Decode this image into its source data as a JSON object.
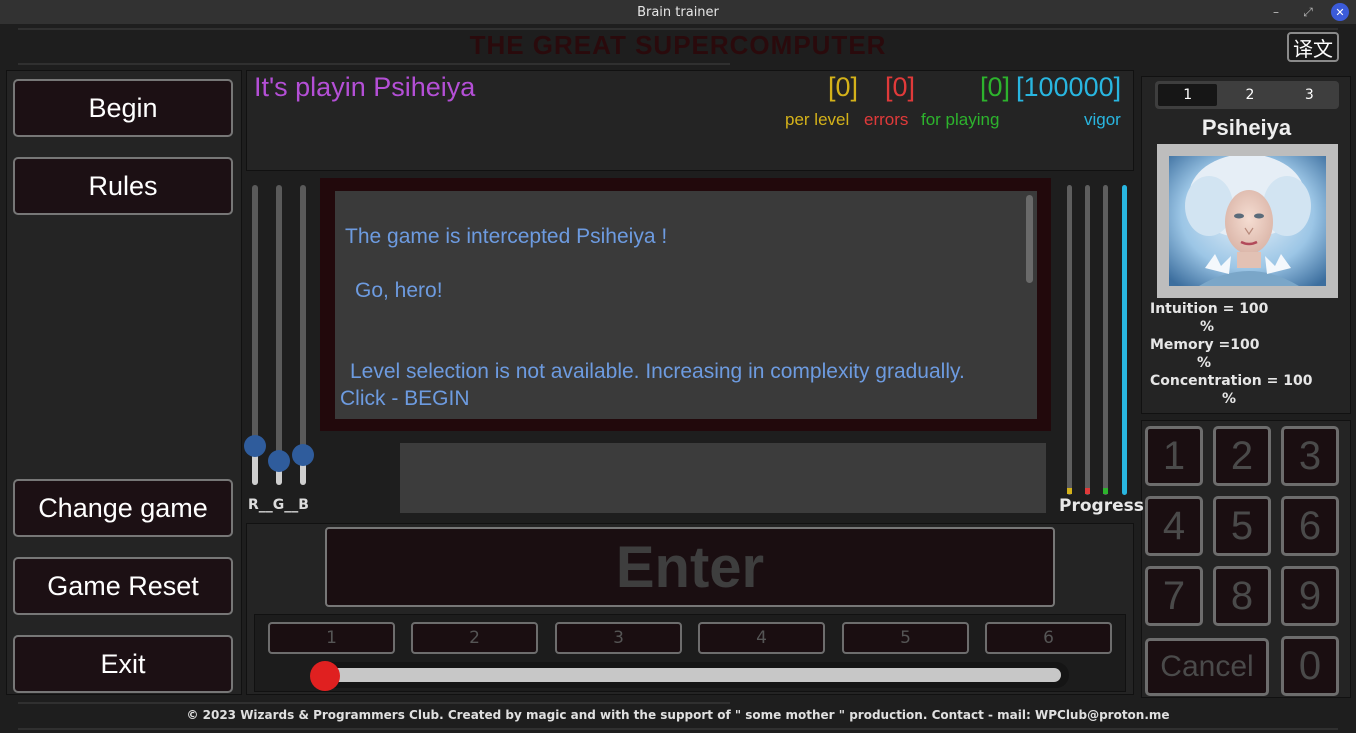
{
  "window": {
    "title": "Brain trainer"
  },
  "header": {
    "title": "THE GREAT SUPERCOMPUTER",
    "lang_button": "译文"
  },
  "left_menu": {
    "begin": "Begin",
    "rules": "Rules",
    "change_game": "Change game",
    "game_reset": "Game Reset",
    "exit": "Exit"
  },
  "status": {
    "playing_text": "It's playin Psiheiya",
    "per_level": {
      "value": "[0]",
      "label": "per level",
      "color": "#d4b21a"
    },
    "errors": {
      "value": "[0]",
      "label": "errors",
      "color": "#e03a3a"
    },
    "for_playing": {
      "value": "[0]",
      "label": "for playing",
      "color": "#2db32d"
    },
    "vigor": {
      "value": "[100000]",
      "label": "vigor",
      "color": "#29b6e0"
    }
  },
  "rgb_sliders": {
    "label": "R__G__B",
    "r_level": 0.13,
    "g_level": 0.08,
    "b_level": 0.1
  },
  "message": {
    "line1": "The game is intercepted Psiheiya !",
    "line2": "Go, hero!",
    "line3": "Level selection is not available. Increasing in complexity gradually.",
    "line4": "Click - BEGIN"
  },
  "answer_field": {
    "value": ""
  },
  "progress": {
    "label": "Progress",
    "bars": [
      {
        "color": "#d4b21a",
        "level": 0
      },
      {
        "color": "#e03a3a",
        "level": 0
      },
      {
        "color": "#2db32d",
        "level": 0
      },
      {
        "color": "#29b6e0",
        "level": 1
      }
    ]
  },
  "enter_button": "Enter",
  "levels": [
    "1",
    "2",
    "3",
    "4",
    "5",
    "6"
  ],
  "level_slider": {
    "value": 0
  },
  "character": {
    "tabs": [
      "1",
      "2",
      "3"
    ],
    "active_tab": "1",
    "name": "Psiheiya",
    "intuition_label": "Intuition = 100",
    "intuition_unit": "%",
    "memory_label": "Memory =100",
    "memory_unit": "%",
    "concentration_label": "Concentration = 100",
    "concentration_unit": "%"
  },
  "keypad": {
    "keys": [
      "1",
      "2",
      "3",
      "4",
      "5",
      "6",
      "7",
      "8",
      "9"
    ],
    "zero": "0",
    "cancel": "Cancel"
  },
  "footer": "© 2023 Wizards & Programmers Club. Created by magic and with the support of \" some mother \" production. Contact - mail: WPClub@proton.me"
}
